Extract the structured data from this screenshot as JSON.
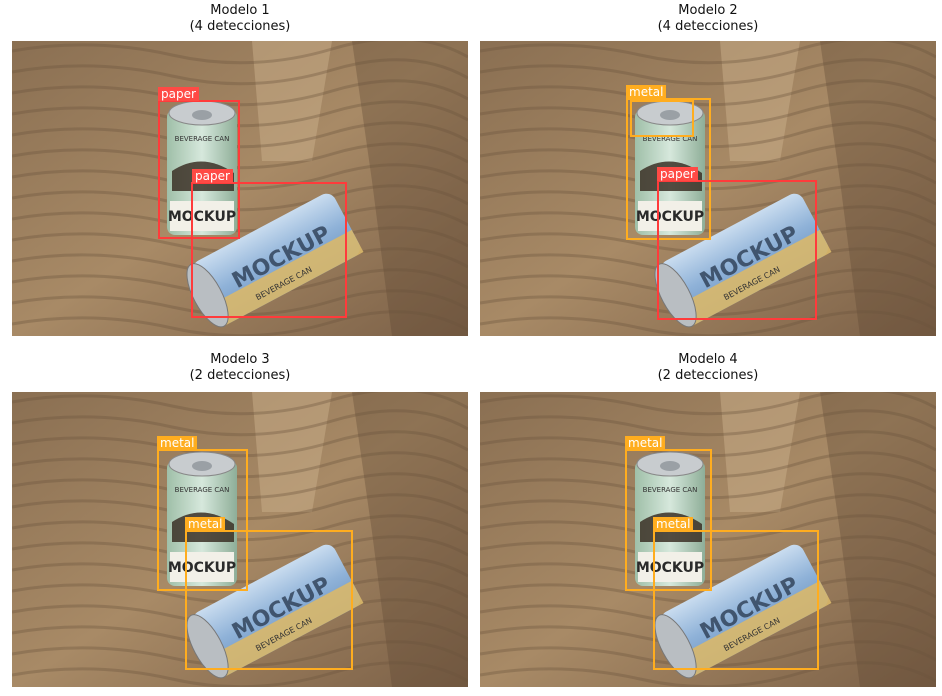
{
  "colors": {
    "metal": "#ffad1f",
    "paper": "#ff4a45"
  },
  "panels": [
    {
      "title": "Modelo 1",
      "subtitle": "(4 detecciones)",
      "detections": [
        {
          "label": "paper",
          "class": "paper"
        },
        {
          "label": "paper",
          "class": "paper"
        }
      ]
    },
    {
      "title": "Modelo 2",
      "subtitle": "(4 detecciones)",
      "detections": [
        {
          "label": "metal",
          "class": "metal"
        },
        {
          "label": "paper",
          "class": "paper"
        }
      ]
    },
    {
      "title": "Modelo 3",
      "subtitle": "(2 detecciones)",
      "detections": [
        {
          "label": "metal",
          "class": "metal"
        },
        {
          "label": "metal",
          "class": "metal"
        }
      ]
    },
    {
      "title": "Modelo 4",
      "subtitle": "(2 detecciones)",
      "detections": [
        {
          "label": "metal",
          "class": "metal"
        },
        {
          "label": "metal",
          "class": "metal"
        }
      ]
    }
  ],
  "can": {
    "brand_text": "MOCKUP",
    "label_text": "BEVERAGE CAN"
  }
}
